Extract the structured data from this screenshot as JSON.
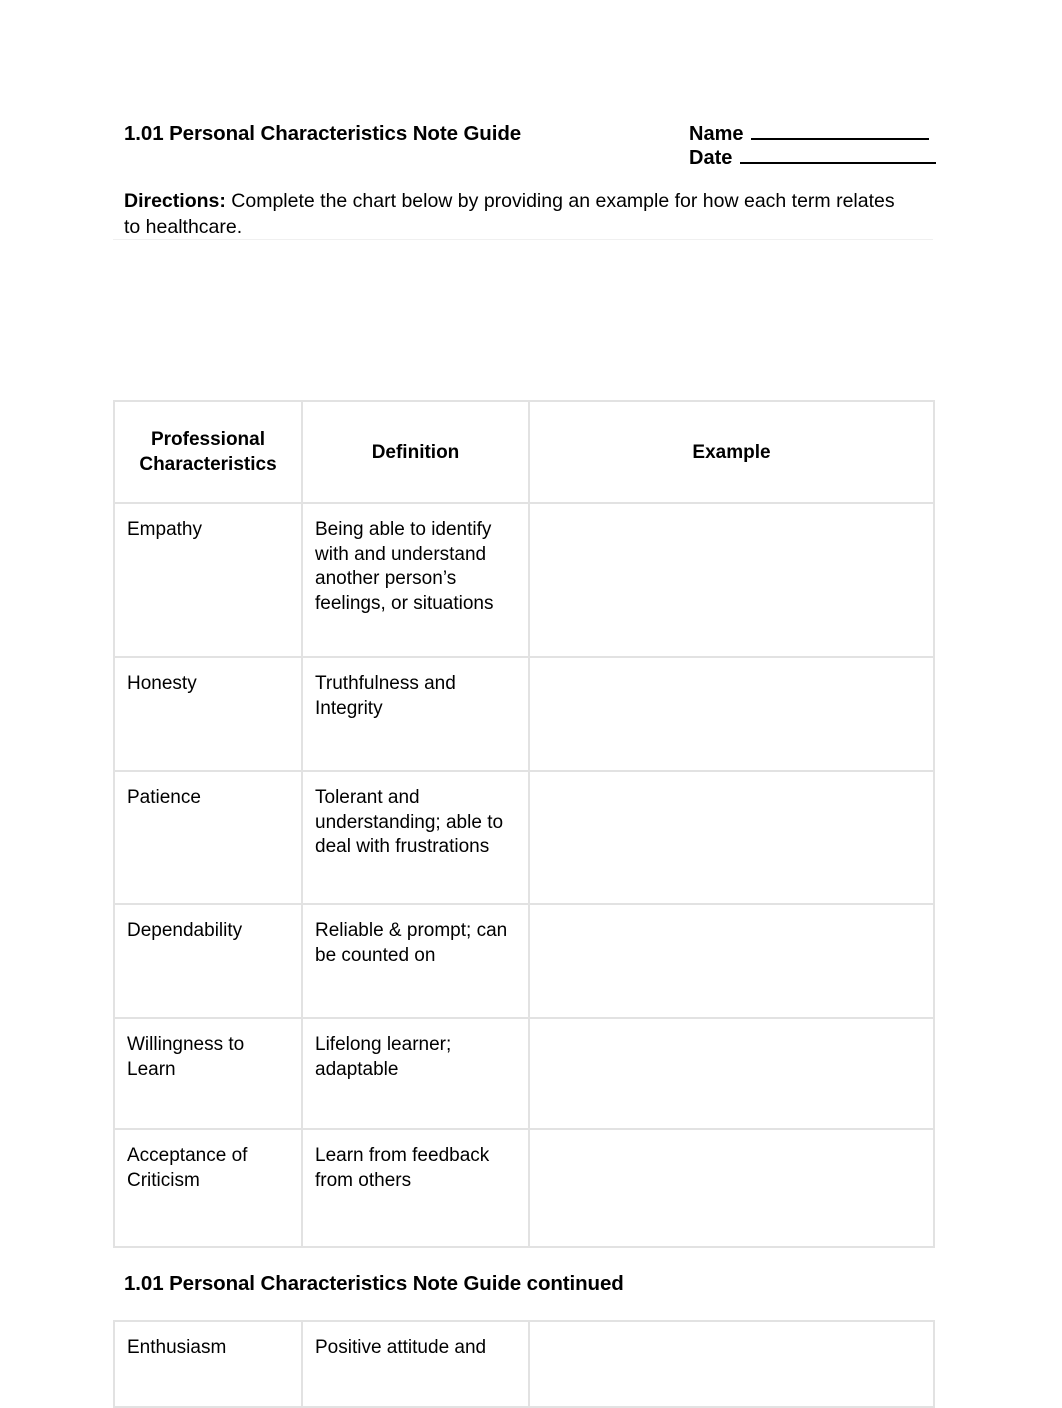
{
  "document": {
    "title": "1.01 Personal Characteristics Note Guide",
    "continued_title": "1.01 Personal Characteristics Note Guide continued",
    "name_label": "Name",
    "date_label": "Date",
    "directions_label": "Directions:",
    "directions_text": " Complete the chart below by providing an example for how each term relates to healthcare."
  },
  "table": {
    "headers": {
      "characteristic": "Professional Characteristics",
      "definition": "Definition",
      "example": "Example"
    },
    "rows": [
      {
        "characteristic": "Empathy",
        "definition": "Being able to identify with and understand another person’s feelings, or situations",
        "example": ""
      },
      {
        "characteristic": "Honesty",
        "definition": "Truthfulness and Integrity",
        "example": ""
      },
      {
        "characteristic": "Patience",
        "definition": "Tolerant and understanding; able to deal with frustrations",
        "example": ""
      },
      {
        "characteristic": "Dependability",
        "definition": "Reliable & prompt; can be counted on",
        "example": ""
      },
      {
        "characteristic": "Willingness to Learn",
        "definition": "Lifelong learner; adaptable",
        "example": ""
      },
      {
        "characteristic": "Acceptance of Criticism",
        "definition": "Learn from feedback from others",
        "example": ""
      }
    ],
    "continued_rows": [
      {
        "characteristic": "Enthusiasm",
        "definition": "Positive attitude and",
        "example": ""
      }
    ]
  },
  "colors": {
    "text": "#000000",
    "table_border": "#e2e2e2",
    "page_background": "#ffffff",
    "thin_rule": "#f0f0f0"
  }
}
